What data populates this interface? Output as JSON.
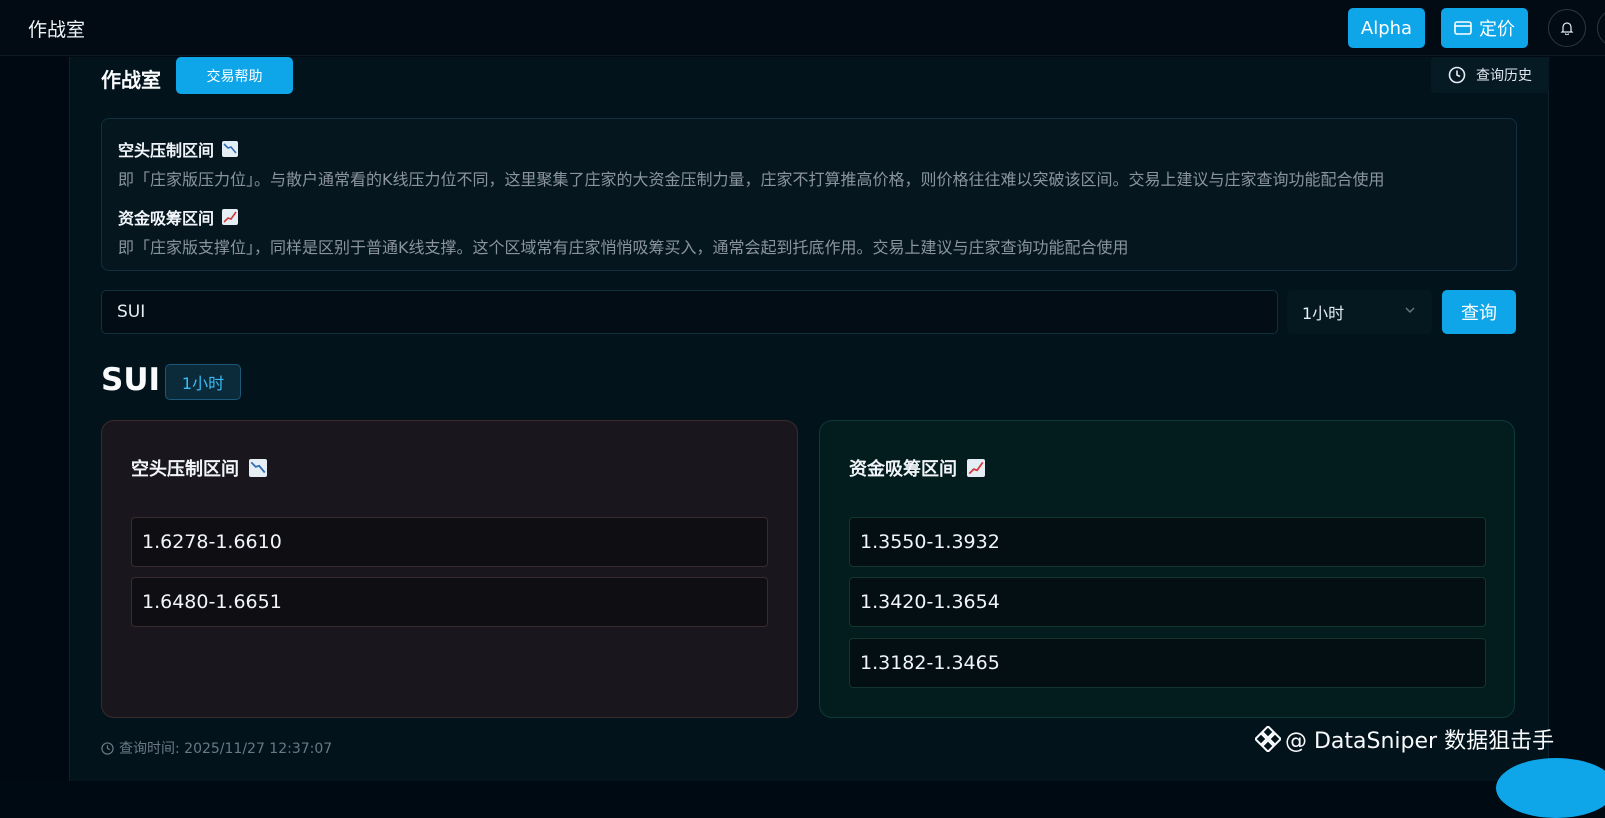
{
  "header": {
    "title": "作战室",
    "alpha_label": "Alpha",
    "pricing_label": "定价",
    "icons": {
      "pricing": "card-icon",
      "notifications": "bell-icon"
    }
  },
  "page": {
    "section_title": "作战室",
    "help_label": "交易帮助",
    "history_label": "查询历史"
  },
  "info": {
    "short_title": "空头压制区间",
    "short_desc": "即「庄家版压力位」。与散户通常看的K线压力位不同，这里聚集了庄家的大资金压制力量，庄家不打算推高价格，则价格往往难以突破该区间。交易上建议与庄家查询功能配合使用",
    "long_title": "资金吸筹区间",
    "long_desc": "即「庄家版支撑位」，同样是区别于普通K线支撑。这个区域常有庄家悄悄吸筹买入，通常会起到托底作用。交易上建议与庄家查询功能配合使用"
  },
  "search": {
    "value": "SUI",
    "timeframe": "1小时",
    "query_label": "查询"
  },
  "result": {
    "symbol": "SUI",
    "timeframe_badge": "1小时",
    "short_card": {
      "title": "空头压制区间",
      "zones": [
        "1.6278-1.6610",
        "1.6480-1.6651"
      ]
    },
    "long_card": {
      "title": "资金吸筹区间",
      "zones": [
        "1.3550-1.3932",
        "1.3420-1.3654",
        "1.3182-1.3465"
      ]
    },
    "query_time": "查询时间: 2025/11/27 12:37:07"
  },
  "watermark": {
    "text": "@ DataSniper 数据狙击手"
  },
  "colors": {
    "accent": "#0ea5e9",
    "short_card_bg": "#1a161d",
    "long_card_bg": "#031c1e"
  }
}
